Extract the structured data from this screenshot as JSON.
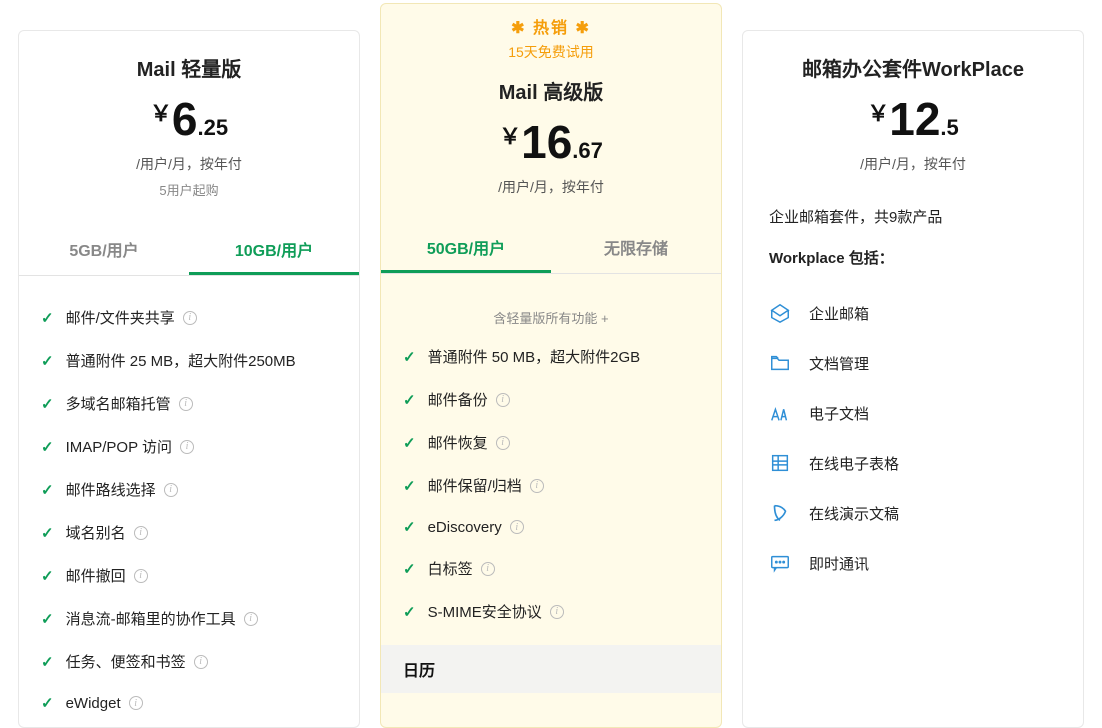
{
  "plans": {
    "lite": {
      "title": "Mail 轻量版",
      "currency": "￥",
      "price_big": "6",
      "price_dec": ".25",
      "sub": "/用户/月，按年付",
      "sub2": "5用户起购",
      "tabs": [
        "5GB/用户",
        "10GB/用户"
      ],
      "features": [
        {
          "t": "邮件/文件夹共享",
          "info": true
        },
        {
          "t": "普通附件 25 MB，超大附件250MB",
          "info": false
        },
        {
          "t": "多域名邮箱托管",
          "info": true
        },
        {
          "t": "IMAP/POP 访问",
          "info": true
        },
        {
          "t": "邮件路线选择",
          "info": true
        },
        {
          "t": "域名别名",
          "info": true
        },
        {
          "t": "邮件撤回",
          "info": true
        },
        {
          "t": "消息流-邮箱里的协作工具",
          "info": true
        },
        {
          "t": "任务、便签和书签",
          "info": true
        },
        {
          "t": "eWidget",
          "info": true
        }
      ]
    },
    "pro": {
      "hot": "✱ 热销 ✱",
      "trial": "15天免费试用",
      "title": "Mail 高级版",
      "currency": "￥",
      "price_big": "16",
      "price_dec": ".67",
      "sub": "/用户/月，按年付",
      "tabs": [
        "50GB/用户",
        "无限存储"
      ],
      "features_note": "含轻量版所有功能 +",
      "features": [
        {
          "t": "普通附件 50 MB，超大附件2GB",
          "info": false
        },
        {
          "t": "邮件备份",
          "info": true
        },
        {
          "t": "邮件恢复",
          "info": true
        },
        {
          "t": "邮件保留/归档",
          "info": true
        },
        {
          "t": "eDiscovery",
          "info": true
        },
        {
          "t": "白标签",
          "info": true
        },
        {
          "t": "S-MIME安全协议",
          "info": true
        }
      ],
      "section": "日历"
    },
    "wp": {
      "title": "邮箱办公套件WorkPlace",
      "currency": "￥",
      "price_big": "12",
      "price_dec": ".5",
      "sub": "/用户/月，按年付",
      "line1": "企业邮箱套件，共9款产品",
      "line2": "Workplace 包括：",
      "products": [
        {
          "t": "企业邮箱",
          "icon": "mail"
        },
        {
          "t": "文档管理",
          "icon": "folder"
        },
        {
          "t": "电子文档",
          "icon": "writer"
        },
        {
          "t": "在线电子表格",
          "icon": "sheet"
        },
        {
          "t": "在线演示文稿",
          "icon": "show"
        },
        {
          "t": "即时通讯",
          "icon": "chat"
        }
      ]
    }
  }
}
